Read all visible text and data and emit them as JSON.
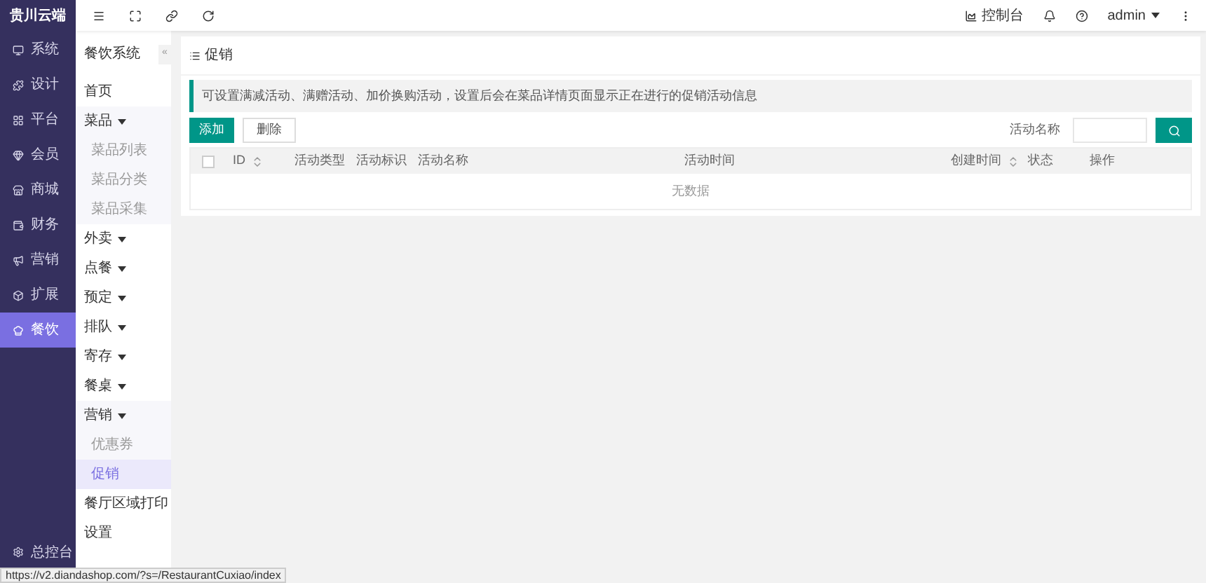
{
  "brand": "贵川云端",
  "nav": [
    {
      "label": "系统",
      "selected": false
    },
    {
      "label": "设计",
      "selected": false
    },
    {
      "label": "平台",
      "selected": false
    },
    {
      "label": "会员",
      "selected": false
    },
    {
      "label": "商城",
      "selected": false
    },
    {
      "label": "财务",
      "selected": false
    },
    {
      "label": "营销",
      "selected": false
    },
    {
      "label": "扩展",
      "selected": false
    },
    {
      "label": "餐饮",
      "selected": true
    }
  ],
  "nav_bottom": {
    "label": "总控台"
  },
  "subnav": {
    "title": "餐饮系统",
    "collapse": "«",
    "items": [
      {
        "label": "首页",
        "kind": "link"
      },
      {
        "label": "菜品",
        "kind": "group",
        "children": [
          {
            "label": "菜品列表",
            "selected": false
          },
          {
            "label": "菜品分类",
            "selected": false
          },
          {
            "label": "菜品采集",
            "selected": false
          }
        ]
      },
      {
        "label": "外卖",
        "kind": "group"
      },
      {
        "label": "点餐",
        "kind": "group"
      },
      {
        "label": "预定",
        "kind": "group"
      },
      {
        "label": "排队",
        "kind": "group"
      },
      {
        "label": "寄存",
        "kind": "group"
      },
      {
        "label": "餐桌",
        "kind": "group"
      },
      {
        "label": "营销",
        "kind": "group",
        "children": [
          {
            "label": "优惠券",
            "selected": false
          },
          {
            "label": "促销",
            "selected": true
          }
        ]
      },
      {
        "label": "餐厅区域打印",
        "kind": "link"
      },
      {
        "label": "设置",
        "kind": "link"
      }
    ]
  },
  "topbar": {
    "console": "控制台",
    "user": "admin"
  },
  "panel": {
    "title": "促销",
    "notice": "可设置满减活动、满赠活动、加价换购活动，设置后会在菜品详情页面显示正在进行的促销活动信息",
    "buttons": [
      {
        "label": "添加",
        "kind": "primary"
      },
      {
        "label": "删除",
        "kind": "default"
      }
    ],
    "search_label": "活动名称",
    "table": {
      "select_all": {
        "checked": false
      },
      "columns": [
        {
          "label": "ID",
          "sortable": true
        },
        {
          "label": "活动类型",
          "sortable": false
        },
        {
          "label": "活动标识",
          "sortable": false
        },
        {
          "label": "活动名称",
          "sortable": false
        },
        {
          "label": "活动时间",
          "sortable": false
        },
        {
          "label": "创建时间",
          "sortable": true
        },
        {
          "label": "状态",
          "sortable": false
        },
        {
          "label": "操作",
          "sortable": false
        }
      ],
      "empty": "无数据"
    }
  },
  "status_bar": "https://v2.diandashop.com/?s=/RestaurantCuxiao/index"
}
